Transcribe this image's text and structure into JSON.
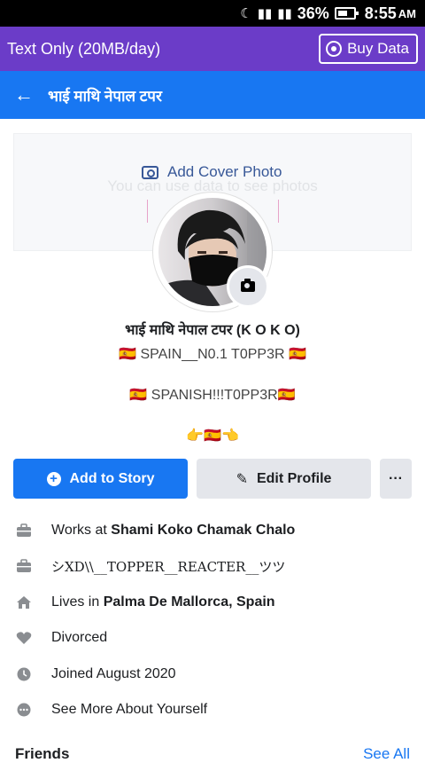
{
  "status_bar": {
    "battery": "36%",
    "time": "8:55",
    "ampm": "AM"
  },
  "data_banner": {
    "label": "Text Only (20MB/day)",
    "buy_label": "Buy Data"
  },
  "app_bar": {
    "title": "भाई माथि नेपाल टपर"
  },
  "cover": {
    "add_label": "Add Cover Photo",
    "ghost_text": "You can use data to see photos"
  },
  "profile": {
    "name": "भाई माथि नेपाल टपर (K O K O)",
    "bio": [
      "🇪🇸 SPAIN__N0.1 T0PP3R 🇪🇸",
      "🇪🇸 SPANISH!!!T0PP3R🇪🇸",
      "👉🇪🇸👈"
    ]
  },
  "actions": {
    "story_label": "Add to Story",
    "edit_label": "Edit Profile",
    "more_label": "···"
  },
  "details": {
    "work1_prefix": "Works at",
    "work1_place": "Shami Koko Chamak Chalo",
    "work2": "シXD\\\\__TOPPER__REACTER__ツツ",
    "lives_prefix": "Lives in",
    "lives_place": "Palma De Mallorca, Spain",
    "relationship": "Divorced",
    "joined": "Joined August 2020",
    "see_more": "See More About Yourself"
  },
  "friends": {
    "title": "Friends",
    "see_all": "See All"
  },
  "colors": {
    "fb_blue": "#1877f2",
    "banner_purple": "#6b3cc8",
    "grey_button": "#e4e6eb"
  }
}
